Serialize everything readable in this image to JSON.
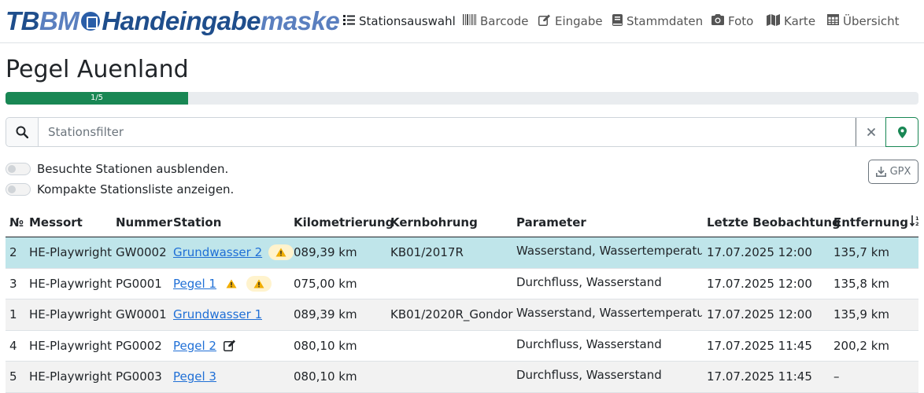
{
  "brand": {
    "p1": "TB",
    "p2": "BM",
    "p3": "Handeingabe",
    "p4": "maske"
  },
  "nav": [
    {
      "label": "Stationsauswahl",
      "icon": "list-icon",
      "active": true
    },
    {
      "label": "Barcode",
      "icon": "barcode-icon"
    },
    {
      "label": "Eingabe",
      "icon": "edit-icon"
    },
    {
      "label": "Stammdaten",
      "icon": "book-icon"
    },
    {
      "label": "Foto",
      "icon": "camera-icon"
    },
    {
      "label": "Karte",
      "icon": "map-icon"
    },
    {
      "label": "Übersicht",
      "icon": "table-icon"
    }
  ],
  "page": {
    "title": "Pegel Auenland"
  },
  "progress": {
    "label": "1/5",
    "value": 0.2
  },
  "search": {
    "placeholder": "Stationsfilter",
    "value": ""
  },
  "toggles": {
    "hide_visited": "Besuchte Stationen ausblenden.",
    "compact": "Kompakte Stationsliste anzeigen."
  },
  "gpx": {
    "label": "GPX"
  },
  "table": {
    "headers": {
      "nr": "№",
      "messort": "Messort",
      "nummer": "Nummer",
      "station": "Station",
      "km": "Kilometrierung",
      "kern": "Kernbohrung",
      "param": "Parameter",
      "letzte": "Letzte Beobachtung",
      "entf": "Entfernung"
    },
    "rows": [
      {
        "nr": "2",
        "messort": "HE-Playwright",
        "nummer": "GW0002",
        "station": "Grundwasser 2",
        "km": "089,39 km",
        "kern": "KB01/2017R",
        "param": "Wasserstand, Wassertemperatur",
        "letzte": "17.07.2025 12:00",
        "entf": "135,7 km"
      },
      {
        "nr": "3",
        "messort": "HE-Playwright",
        "nummer": "PG0001",
        "station": "Pegel 1",
        "km": "075,00 km",
        "kern": "",
        "param": "Durchfluss, Wasserstand",
        "letzte": "17.07.2025 12:00",
        "entf": "135,8 km"
      },
      {
        "nr": "1",
        "messort": "HE-Playwright",
        "nummer": "GW0001",
        "station": "Grundwasser 1",
        "km": "089,39 km",
        "kern": "KB01/2020R_Gondor",
        "param": "Wasserstand, Wassertemperatur",
        "letzte": "17.07.2025 12:00",
        "entf": "135,9 km"
      },
      {
        "nr": "4",
        "messort": "HE-Playwright",
        "nummer": "PG0002",
        "station": "Pegel 2",
        "km": "080,10 km",
        "kern": "",
        "param": "Durchfluss, Wasserstand",
        "letzte": "17.07.2025 11:45",
        "entf": "200,2 km"
      },
      {
        "nr": "5",
        "messort": "HE-Playwright",
        "nummer": "PG0003",
        "station": "Pegel 3",
        "km": "080,10 km",
        "kern": "",
        "param": "Durchfluss, Wasserstand",
        "letzte": "17.07.2025 11:45",
        "entf": "–"
      }
    ]
  },
  "colors": {
    "accent": "#198754",
    "highlight": "#bfe5ea",
    "link": "#1f6fd6",
    "brand": "#1f4e8c"
  }
}
